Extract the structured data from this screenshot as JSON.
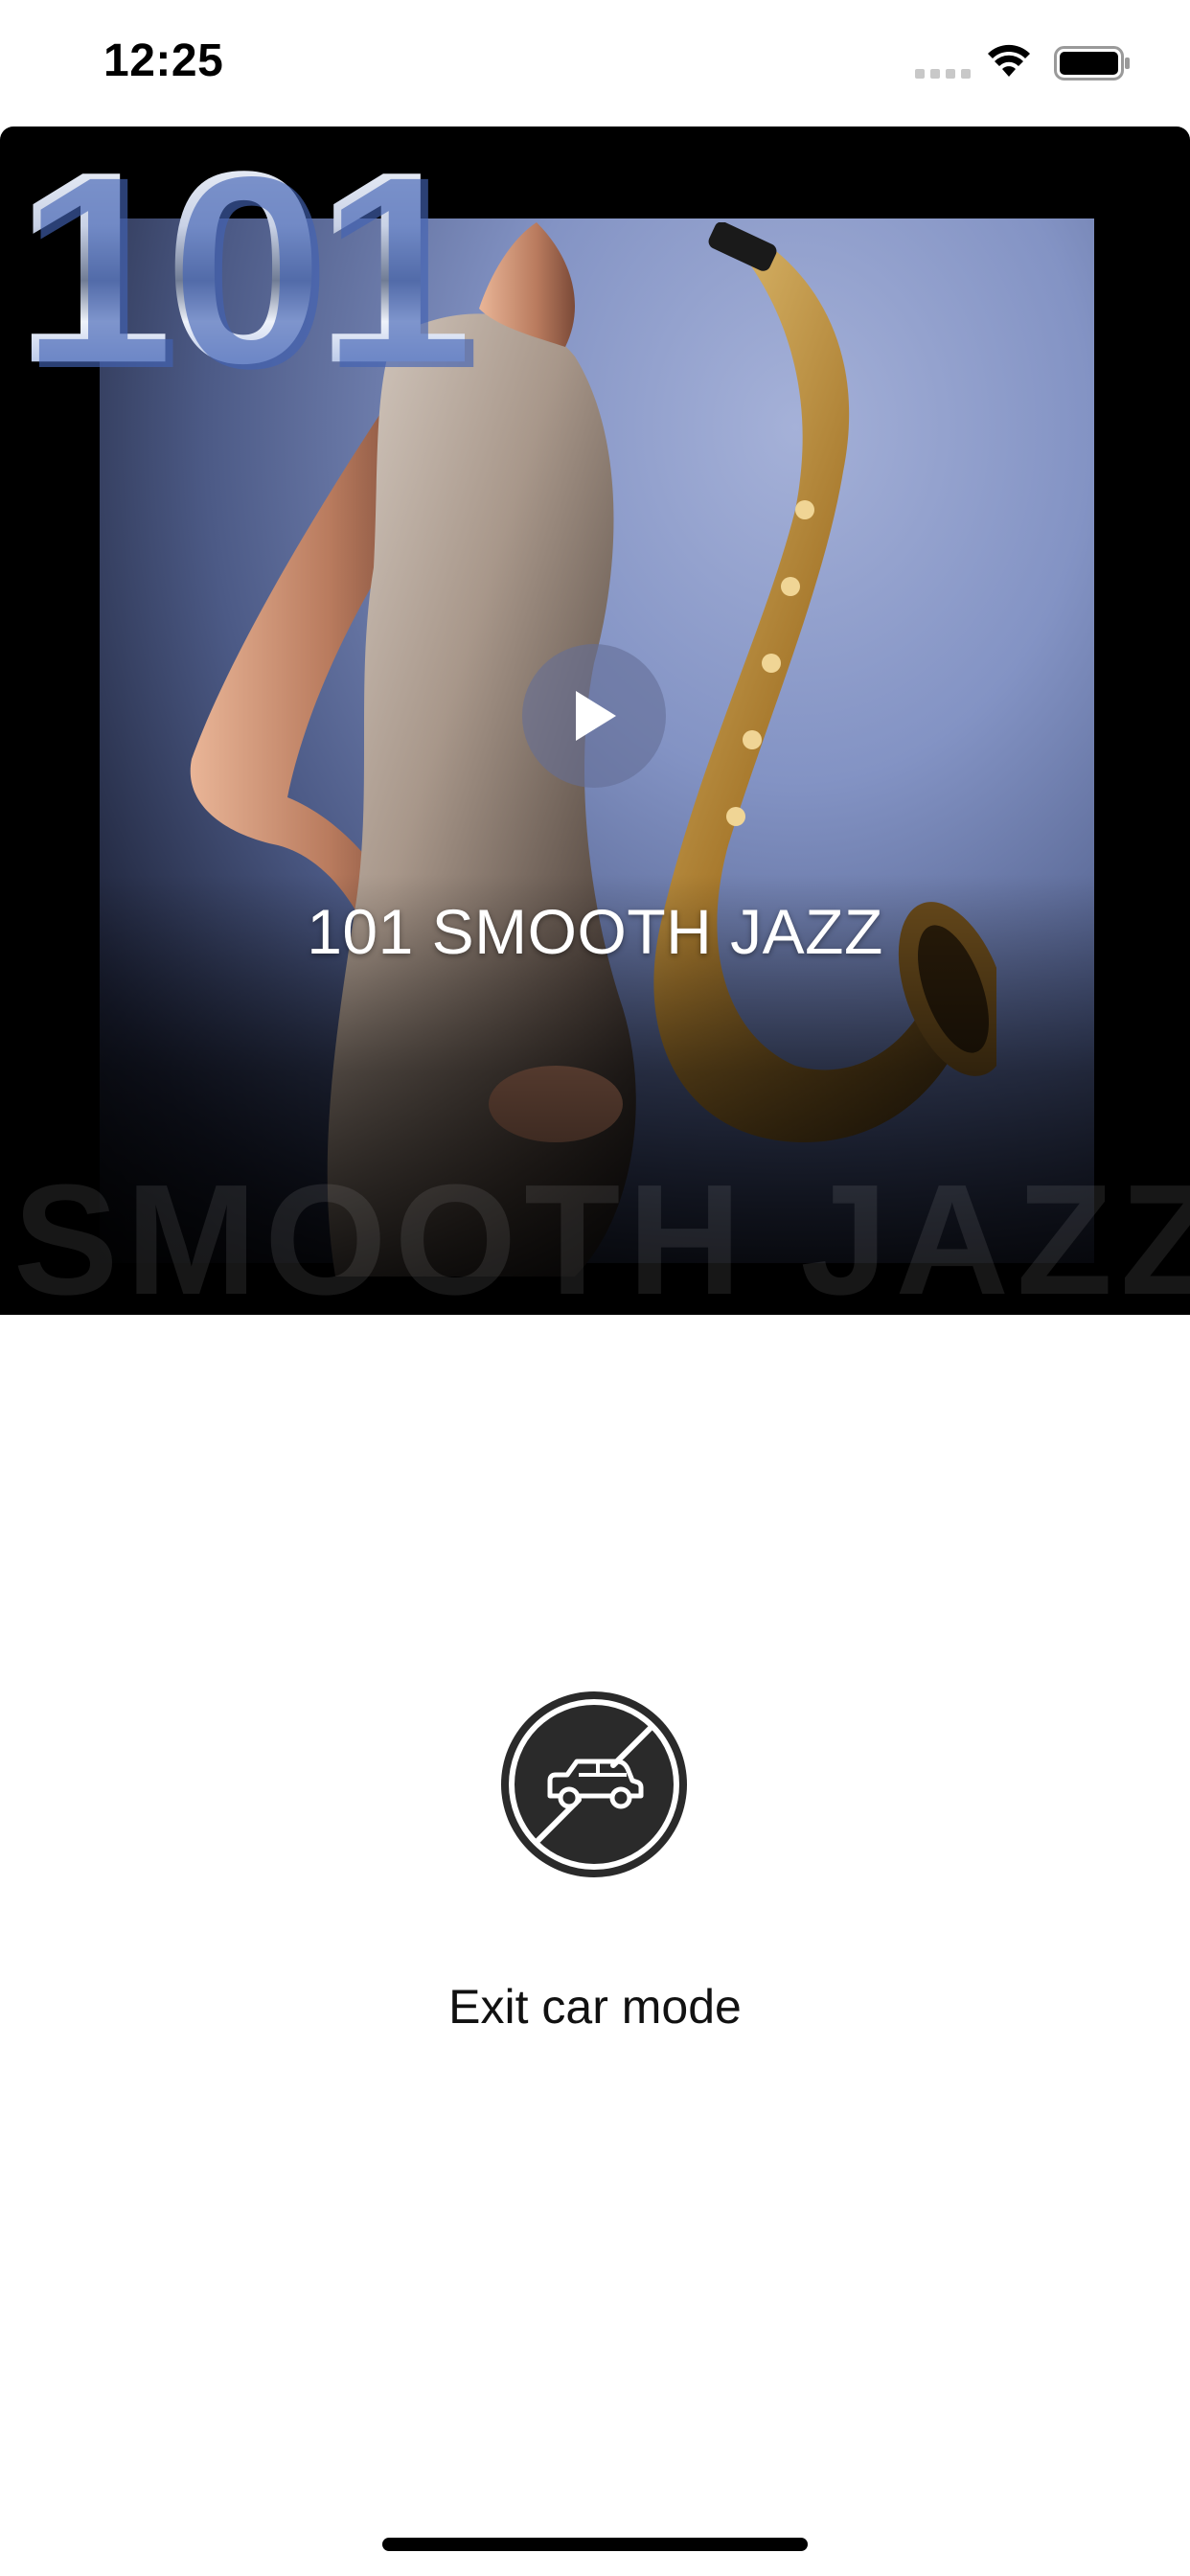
{
  "status_bar": {
    "time": "12:25"
  },
  "artwork": {
    "logo_number": "101",
    "watermark": "SMOOTH JAZZ",
    "play_icon": "play-icon"
  },
  "station": {
    "title": "101 SMOOTH JAZZ"
  },
  "car_mode": {
    "icon": "car-off-icon",
    "exit_label": "Exit car mode"
  },
  "colors": {
    "icon_circle": "#2a2a2a",
    "label_text": "#111111",
    "artwork_bg": "#000000"
  }
}
